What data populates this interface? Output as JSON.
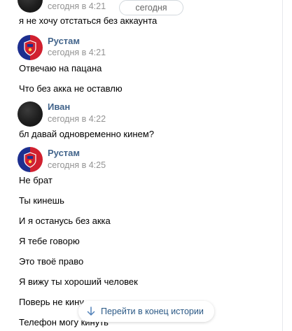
{
  "date_divider": "сегодня",
  "messages": [
    {
      "author": "",
      "time": "сегодня в 4:21",
      "avatar_icon": "dark-profile-avatar",
      "lines": [
        "я не хочу отстаться без аккаунта"
      ]
    },
    {
      "author": "Рустам",
      "time": "сегодня в 4:21",
      "avatar_icon": "cska-logo-avatar",
      "lines": [
        "Отвечаю на пацана",
        "Что без акка не оставлю"
      ]
    },
    {
      "author": "Иван",
      "time": "сегодня в 4:22",
      "avatar_icon": "dark-profile-avatar",
      "lines": [
        "бл давай одновременно кинем?"
      ]
    },
    {
      "author": "Рустам",
      "time": "сегодня в 4:25",
      "avatar_icon": "cska-logo-avatar",
      "lines": [
        "Не брат",
        "Ты кинешь",
        "И я останусь без акка",
        "Я тебе говорю",
        "Это твоё право",
        "Я вижу ты хороший человек",
        "Поверь не кину",
        "Телефон могу кинуть"
      ]
    }
  ],
  "jump_to_end": {
    "label": "Перейти в конец истории",
    "icon": "arrow-down-icon"
  },
  "colors": {
    "author": "#42648b",
    "time": "#939393",
    "link": "#2a5885",
    "border": "#e7e8ec"
  }
}
